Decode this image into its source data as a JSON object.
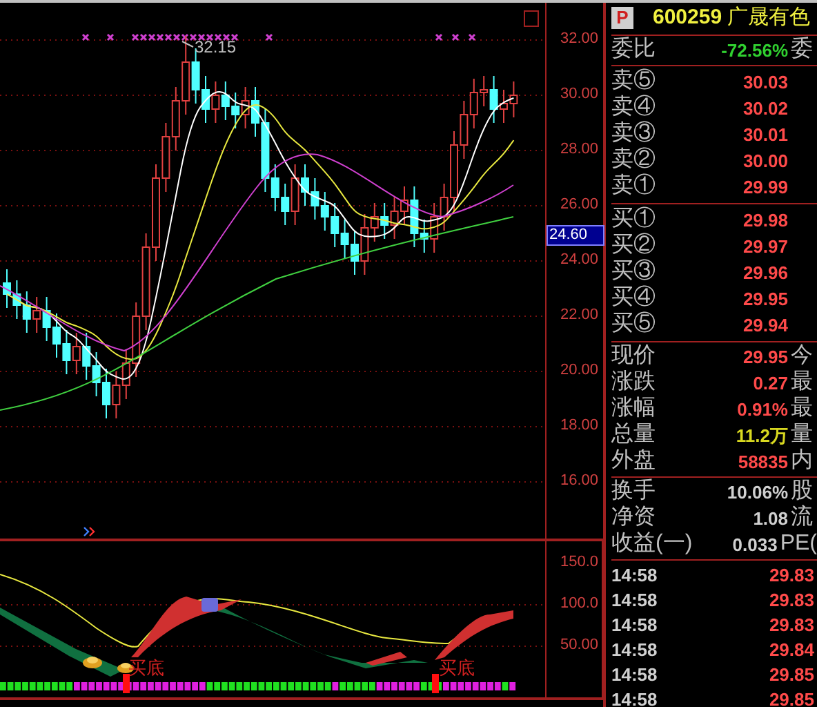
{
  "header": {
    "badge": "P",
    "code": "600259",
    "name": "广晟有色"
  },
  "order_ratio": {
    "label": "委比",
    "value": "-72.56%",
    "right_label": "委"
  },
  "asks": [
    {
      "label": "卖⑤",
      "price": "30.03"
    },
    {
      "label": "卖④",
      "price": "30.02"
    },
    {
      "label": "卖③",
      "price": "30.01"
    },
    {
      "label": "卖②",
      "price": "30.00"
    },
    {
      "label": "卖①",
      "price": "29.99"
    }
  ],
  "bids": [
    {
      "label": "买①",
      "price": "29.98"
    },
    {
      "label": "买②",
      "price": "29.97"
    },
    {
      "label": "买③",
      "price": "29.96"
    },
    {
      "label": "买④",
      "price": "29.95"
    },
    {
      "label": "买⑤",
      "price": "29.94"
    }
  ],
  "quote": [
    {
      "label": "现价",
      "value": "29.95",
      "right_label": "今",
      "color": "#ff4a4a"
    },
    {
      "label": "涨跌",
      "value": "0.27",
      "right_label": "最",
      "color": "#ff4a4a"
    },
    {
      "label": "涨幅",
      "value": "0.91%",
      "right_label": "最",
      "color": "#ff4a4a"
    },
    {
      "label": "总量",
      "value": "11.2万",
      "right_label": "量",
      "color": "#d8d820"
    },
    {
      "label": "外盘",
      "value": "58835",
      "right_label": "内",
      "color": "#ff4a4a"
    }
  ],
  "stats": [
    {
      "label": "换手",
      "value": "10.06%",
      "right_label": "股"
    },
    {
      "label": "净资",
      "value": "1.08",
      "right_label": "流"
    },
    {
      "label": "收益(一)",
      "value": "0.033",
      "right_label": "PE("
    }
  ],
  "trades": [
    {
      "time": "14:58",
      "price": "29.83"
    },
    {
      "time": "14:58",
      "price": "29.83"
    },
    {
      "time": "14:58",
      "price": "29.83"
    },
    {
      "time": "14:58",
      "price": "29.84"
    },
    {
      "time": "14:58",
      "price": "29.85"
    },
    {
      "time": "14:58",
      "price": "29.85"
    }
  ],
  "price_axis": {
    "ticks": [
      "32.00",
      "30.00",
      "28.00",
      "26.00",
      "24.00",
      "22.00",
      "20.00",
      "18.00",
      "16.00"
    ],
    "current": "24.60"
  },
  "indicator_axis": {
    "ticks": [
      "150.0",
      "100.0",
      "50.00"
    ]
  },
  "chart": {
    "high_label": "32.15",
    "signals": [
      "买底",
      "买底"
    ]
  }
}
